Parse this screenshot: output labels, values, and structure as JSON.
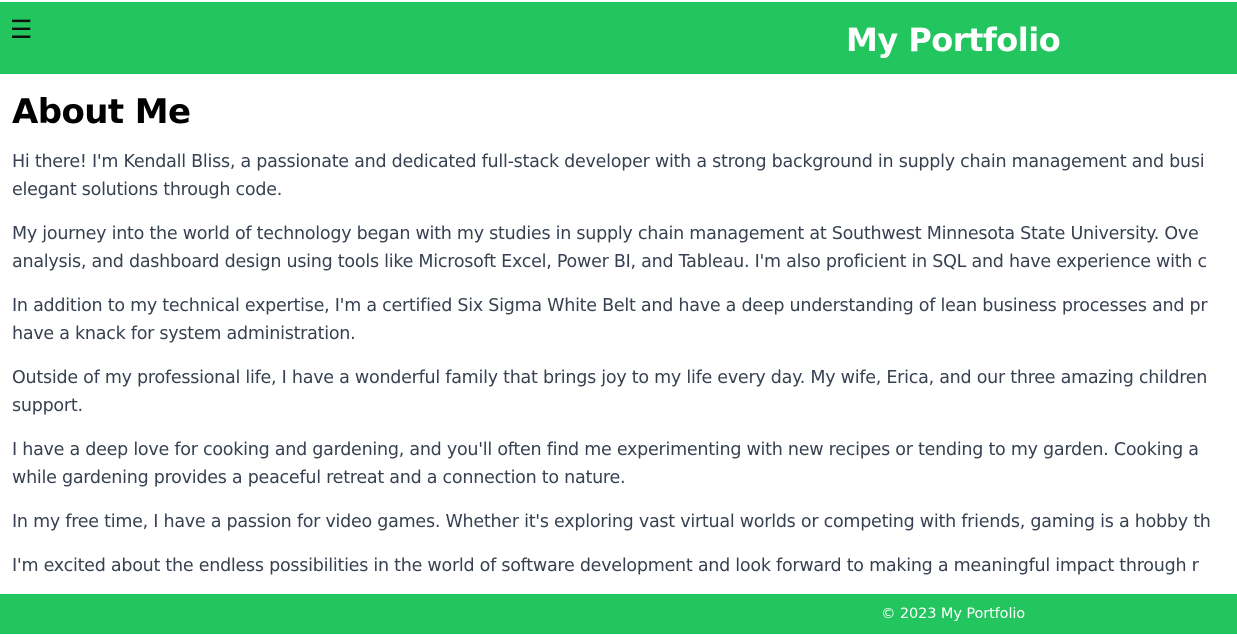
{
  "header": {
    "menu_icon": "☰",
    "title": "My Portfolio"
  },
  "main": {
    "heading": "About Me",
    "paragraphs": [
      {
        "line1": "Hi there! I'm Kendall Bliss, a passionate and dedicated full-stack developer with a strong background in supply chain management and busi",
        "line2": "elegant solutions through code."
      },
      {
        "line1": "My journey into the world of technology began with my studies in supply chain management at Southwest Minnesota State University. Ove",
        "line2": "analysis, and dashboard design using tools like Microsoft Excel, Power BI, and Tableau. I'm also proficient in SQL and have experience with c"
      },
      {
        "line1": "In addition to my technical expertise, I'm a certified Six Sigma White Belt and have a deep understanding of lean business processes and pr",
        "line2": "have a knack for system administration."
      },
      {
        "line1": "Outside of my professional life, I have a wonderful family that brings joy to my life every day. My wife, Erica, and our three amazing children",
        "line2": "support."
      },
      {
        "line1": "I have a deep love for cooking and gardening, and you'll often find me experimenting with new recipes or tending to my garden. Cooking a",
        "line2": "while gardening provides a peaceful retreat and a connection to nature."
      },
      {
        "line1": "In my free time, I have a passion for video games. Whether it's exploring vast virtual worlds or competing with friends, gaming is a hobby th"
      },
      {
        "line1": "I'm excited about the endless possibilities in the world of software development and look forward to making a meaningful impact through r"
      }
    ]
  },
  "footer": {
    "text": "© 2023 My Portfolio"
  },
  "colors": {
    "accent": "#22c55e",
    "body_text": "#374151",
    "heading_text": "#000000",
    "header_text": "#ffffff"
  }
}
